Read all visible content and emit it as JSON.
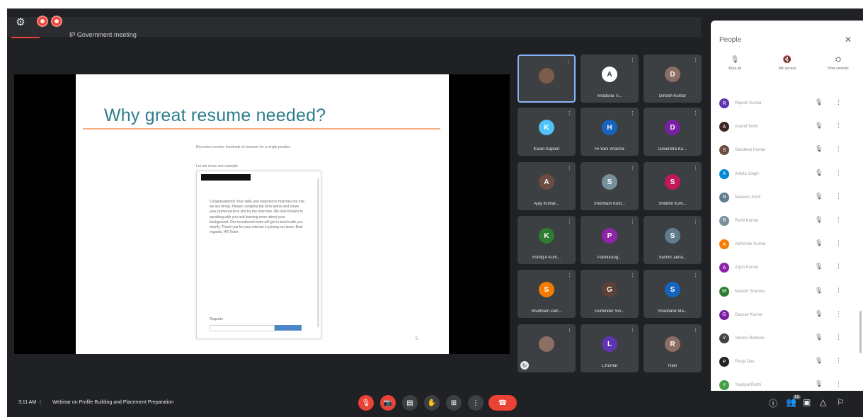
{
  "meeting": {
    "title": "Z ● ●  IP Government Meeting",
    "name_bar_text": "IP Government meeting"
  },
  "slide": {
    "title": "Why great resume needed?",
    "intro": "Recruiters receive hundreds of resumes for a single position",
    "greeting_label": "Let me share one example",
    "doc_body": "Congratulations! Your skills and experience matches the role we are hiring. Please complete the form below and share your preferred time slot for the interview. We look forward to speaking with you and learning more about your background. Our recruitment team will get in touch with you shortly. Thank you for your interest in joining our team. Best regards, HR Team",
    "doc_footer_label": "Regards",
    "page_number": "5"
  },
  "tiles": [
    {
      "name": "",
      "initial": "",
      "color": "#7a5c4a",
      "selected": true
    },
    {
      "name": "Anadurai Ti...",
      "initial": "A",
      "color": "#ffffff"
    },
    {
      "name": "Dinesh Kumar",
      "initial": "D",
      "color": "#8d6e63"
    },
    {
      "name": "Karan Kapoor",
      "initial": "K",
      "color": "#4fc3f7"
    },
    {
      "name": "Hi Yani Sharma",
      "initial": "H",
      "color": "#1565c0"
    },
    {
      "name": "Devendra Ku...",
      "initial": "D",
      "color": "#7b1fa2"
    },
    {
      "name": "Ajay Kumar...",
      "initial": "A",
      "color": "#6d4c41"
    },
    {
      "name": "Shubham Kum...",
      "initial": "S",
      "color": "#78909c"
    },
    {
      "name": "Shobhit Kum...",
      "initial": "S",
      "color": "#c2185b"
    },
    {
      "name": "Kshitij A Kum...",
      "initial": "K",
      "color": "#2e7d32"
    },
    {
      "name": "Pandurang...",
      "initial": "P",
      "color": "#8e24aa"
    },
    {
      "name": "Sachin Jaina...",
      "initial": "S",
      "color": "#607d8b"
    },
    {
      "name": "Shubham Dah...",
      "initial": "S",
      "color": "#f57c00"
    },
    {
      "name": "Gurbinder Sin...",
      "initial": "G",
      "color": "#5d4037"
    },
    {
      "name": "Shashank Ma...",
      "initial": "S",
      "color": "#1565c0"
    },
    {
      "name": "",
      "initial": "",
      "color": "#8d6e63"
    },
    {
      "name": "L.Kumar",
      "initial": "L",
      "color": "#5e35b1"
    },
    {
      "name": "Ravi",
      "initial": "R",
      "color": "#8d6e63"
    }
  ],
  "panel": {
    "title": "People",
    "close_label": "✕",
    "actions": [
      {
        "icon": "🎙",
        "label": "Mute all"
      },
      {
        "icon": "🔇",
        "label": "Mic access"
      },
      {
        "icon": "⛭",
        "label": "Host controls"
      }
    ],
    "participants": [
      {
        "name": "Rajesh Kumar",
        "initial": "R",
        "color": "#5e35b1"
      },
      {
        "name": "Anand Sethi",
        "initial": "A",
        "color": "#3e2723"
      },
      {
        "name": "Sandeep Kumar",
        "initial": "S",
        "color": "#6d4c41"
      },
      {
        "name": "Ankita Singh",
        "initial": "A",
        "color": "#0288d1"
      },
      {
        "name": "Naveen Joshi",
        "initial": "N",
        "color": "#607d8b"
      },
      {
        "name": "Rohit Kumar",
        "initial": "R",
        "color": "#78909c"
      },
      {
        "name": "Abhishek Kumar",
        "initial": "A",
        "color": "#f57c00"
      },
      {
        "name": "Arjun Kumar",
        "initial": "A",
        "color": "#8e24aa"
      },
      {
        "name": "Manish Sharma",
        "initial": "M",
        "color": "#2e7d32"
      },
      {
        "name": "Gaurav Kumar",
        "initial": "G",
        "color": "#7b1fa2"
      },
      {
        "name": "Vikram Rathore",
        "initial": "V",
        "color": "#424242"
      },
      {
        "name": "Pooja Das",
        "initial": "P",
        "color": "#212121"
      },
      {
        "name": "Yashpal Rathi",
        "initial": "Y",
        "color": "#43a047"
      }
    ]
  },
  "bottombar": {
    "time": "3:11 AM",
    "separator": "|",
    "meeting_title": "Webinar on Profile Building and Placement Preparation"
  },
  "colors": {
    "bg": "#202124",
    "tile": "#3c4043",
    "danger": "#ea4335",
    "accent": "#2e7d8c"
  }
}
